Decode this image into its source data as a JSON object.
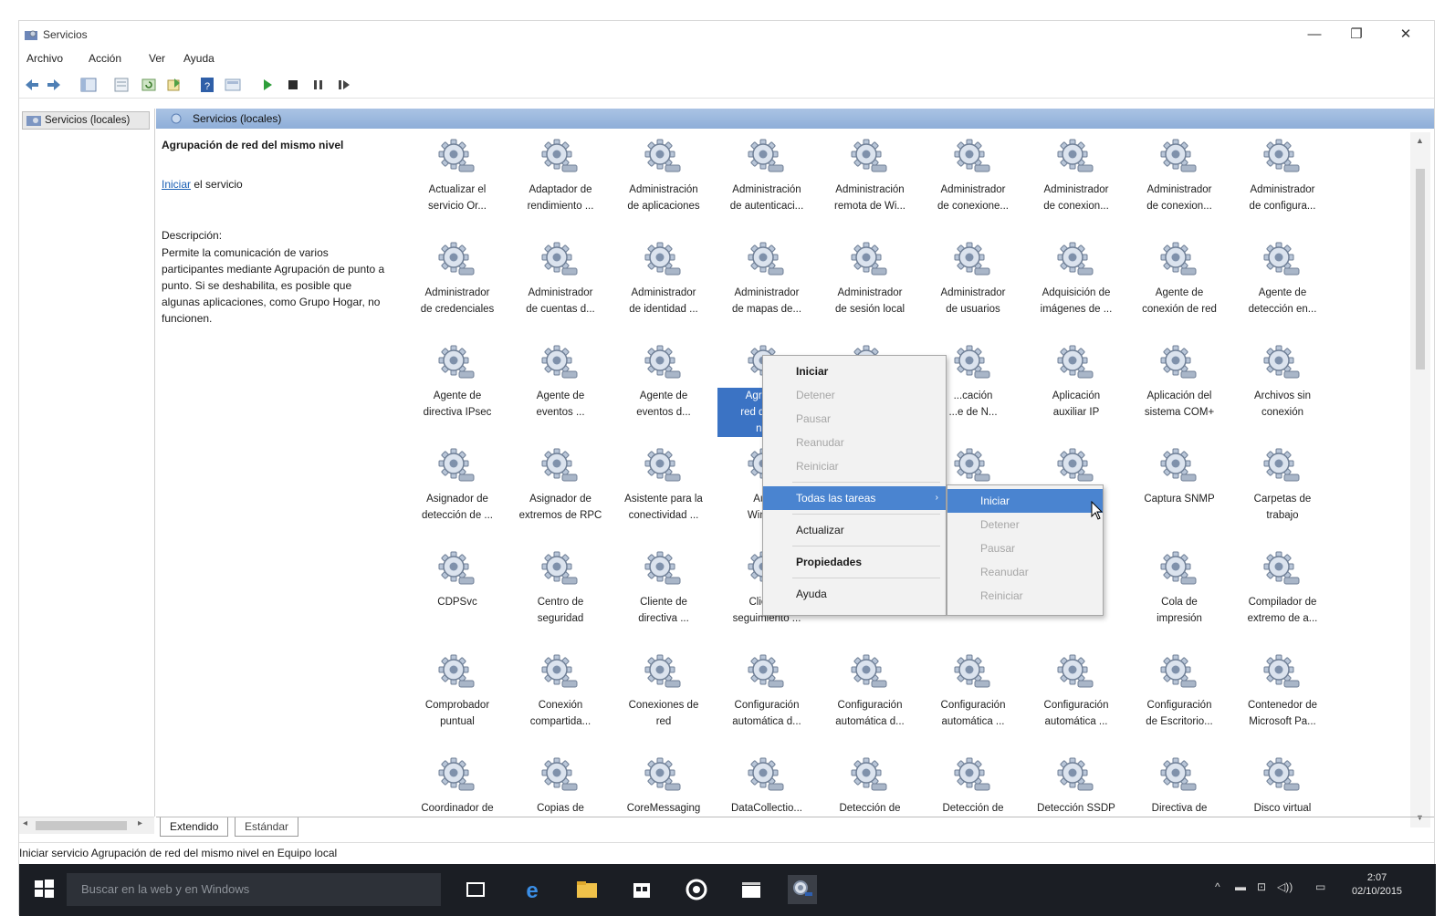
{
  "window": {
    "title": "Servicios",
    "controls": {
      "minimize": "—",
      "maximize": "❐",
      "close": "✕"
    }
  },
  "menu": [
    "Archivo",
    "Acción",
    "Ver",
    "Ayuda"
  ],
  "toolbar": {
    "icons": [
      "back-icon",
      "forward-icon",
      "console-tree-icon",
      "properties-view-icon",
      "refresh-icon",
      "export-icon",
      "help-icon",
      "view-icon",
      "start-service-icon",
      "stop-service-icon",
      "pause-service-icon",
      "restart-service-icon"
    ]
  },
  "tree": {
    "root": "Servicios (locales)"
  },
  "panel": {
    "header": "Servicios (locales)"
  },
  "details": {
    "service_name": "Agrupación de red del mismo nivel",
    "action_link": "Iniciar",
    "action_suffix": " el servicio",
    "description_label": "Descripción:",
    "description": "Permite la comunicación de varios participantes mediante Agrupación de punto a punto. Si se deshabilita, es posible que algunas aplicaciones, como Grupo Hogar, no funcionen."
  },
  "services": [
    [
      "Actualizar el",
      "servicio Or..."
    ],
    [
      "Adaptador de",
      "rendimiento ..."
    ],
    [
      "Administración",
      "de aplicaciones"
    ],
    [
      "Administración",
      "de autenticaci..."
    ],
    [
      "Administración",
      "remota de Wi..."
    ],
    [
      "Administrador",
      "de conexione..."
    ],
    [
      "Administrador",
      "de conexion..."
    ],
    [
      "Administrador",
      "de conexion..."
    ],
    [
      "Administrador",
      "de configura..."
    ],
    [
      "Administrador",
      "de credenciales"
    ],
    [
      "Administrador",
      "de cuentas d..."
    ],
    [
      "Administrador",
      "de identidad ..."
    ],
    [
      "Administrador",
      "de mapas de..."
    ],
    [
      "Administrador",
      "de sesión local"
    ],
    [
      "Administrador",
      "de usuarios"
    ],
    [
      "Adquisición de",
      "imágenes de ..."
    ],
    [
      "Agente de",
      "conexión de red"
    ],
    [
      "Agente de",
      "detección en..."
    ],
    [
      "Agente de",
      "directiva IPsec"
    ],
    [
      "Agente de",
      "eventos ..."
    ],
    [
      "Agente de",
      "eventos d..."
    ],
    [
      "Agrupa...",
      "red del m...",
      "nivel"
    ],
    [
      "...",
      ""
    ],
    [
      "...cación",
      "...e de N..."
    ],
    [
      "Aplicación",
      "auxiliar IP"
    ],
    [
      "Aplicación del",
      "sistema COM+"
    ],
    [
      "Archivos sin",
      "conexión"
    ],
    [
      "Asignador de",
      "detección de ..."
    ],
    [
      "Asignador de",
      "extremos de RPC"
    ],
    [
      "Asistente para la",
      "conectividad ..."
    ],
    [
      "Audio",
      "Windo..."
    ],
    [
      "",
      ""
    ],
    [
      "",
      ""
    ],
    [
      "",
      ""
    ],
    [
      "Captura SNMP",
      ""
    ],
    [
      "Carpetas de",
      "trabajo"
    ],
    [
      "CDPSvc",
      ""
    ],
    [
      "Centro de",
      "seguridad"
    ],
    [
      "Cliente de",
      "directiva ..."
    ],
    [
      "Client...",
      "seguimiento ..."
    ],
    [
      "",
      ""
    ],
    [
      "",
      ""
    ],
    [
      "",
      ""
    ],
    [
      "Cola de",
      "impresión"
    ],
    [
      "Compilador de",
      "extremo de a..."
    ],
    [
      "Comprobador",
      "puntual"
    ],
    [
      "Conexión",
      "compartida..."
    ],
    [
      "Conexiones de",
      "red"
    ],
    [
      "Configuración",
      "automática d..."
    ],
    [
      "Configuración",
      "automática d..."
    ],
    [
      "Configuración",
      "automática ..."
    ],
    [
      "Configuración",
      "automática ..."
    ],
    [
      "Configuración",
      "de Escritorio..."
    ],
    [
      "Contenedor de",
      "Microsoft Pa..."
    ],
    [
      "Coordinador de",
      ""
    ],
    [
      "Copias de",
      ""
    ],
    [
      "CoreMessaging",
      ""
    ],
    [
      "DataCollectio...",
      ""
    ],
    [
      "Detección de",
      ""
    ],
    [
      "Detección de",
      ""
    ],
    [
      "Detección SSDP",
      ""
    ],
    [
      "Directiva de",
      ""
    ],
    [
      "Disco virtual",
      ""
    ]
  ],
  "context_menu": {
    "items": [
      "Iniciar",
      "Detener",
      "Pausar",
      "Reanudar",
      "Reiniciar",
      "Todas las tareas",
      "Actualizar",
      "Propiedades",
      "Ayuda"
    ],
    "submenu_arrow": "›",
    "submenu": [
      "Iniciar",
      "Detener",
      "Pausar",
      "Reanudar",
      "Reiniciar"
    ]
  },
  "tabs": [
    "Extendido",
    "Estándar"
  ],
  "status": "Iniciar servicio Agrupación de red del mismo nivel en Equipo local",
  "taskbar": {
    "search_placeholder": "Buscar en la web y en Windows",
    "apps": [
      "task-view-icon",
      "edge-icon",
      "file-explorer-icon",
      "store-icon",
      "media-icon",
      "clapper-icon",
      "services-app-icon"
    ],
    "tray": [
      "^",
      "▬",
      "⊡",
      "◁))",
      "▭"
    ],
    "time": "2:07",
    "date": "02/10/2015"
  },
  "colors": {
    "header_blue": "#8eaed8",
    "selection_blue": "#3b73c4",
    "menu_highlight": "#4a84d0",
    "taskbar": "#1b1e24"
  }
}
